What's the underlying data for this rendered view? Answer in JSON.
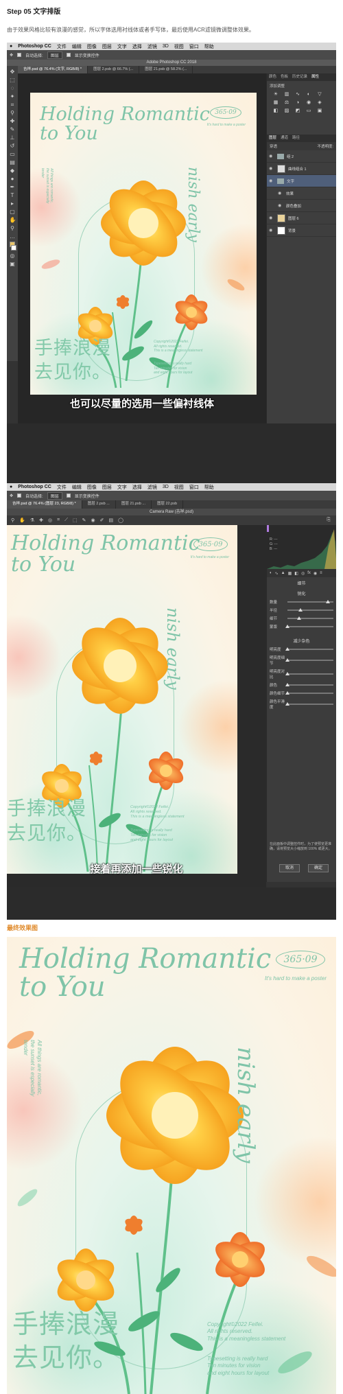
{
  "header": {
    "step_title": "Step 05 文字排版",
    "description": "由于效果风格比较有浪漫的感觉，所以字体选用衬线体或者手写体，最后使用ACR滤镜微调整体效果。"
  },
  "poster": {
    "title_line1": "Holding Romantic",
    "title_line2": "to You",
    "date": "365·09",
    "side_note": "It's hard to make a poster",
    "vertical_text": "nish early",
    "left_vertical": "All things are romantic,\nthe sunset is especially\ntender",
    "title_cn_line1": "手捧浪漫",
    "title_cn_line2": "去见你。",
    "copyright": "Copyright©2022 Feifei.\nAll rights reserved.\nThis is a meaningless statement",
    "typesetting": "Typesetting is really hard\nTen minutes for vision\nand eight hours for layout",
    "colors": {
      "accent_green": "#7fc4a8",
      "petal_yellow": "#f7b733",
      "petal_orange": "#ef7e2e",
      "stem_green": "#5fc08a"
    }
  },
  "shot1": {
    "menubar": [
      "Photoshop CC",
      "文件",
      "编辑",
      "图像",
      "图层",
      "文字",
      "选择",
      "滤镜",
      "3D",
      "视图",
      "窗口",
      "帮助"
    ],
    "options": {
      "auto_select": "自动选择:",
      "auto_select_value": "图层",
      "show_transform": "显示变换控件"
    },
    "window_title": "Adobe Photoshop CC 2018",
    "tabs": [
      "吉祥.psd @ 76.4% (文字, RGB/8) *",
      "图层 2.psb @ 66.7% (...",
      "图层 21.psb @ 58.2% (..."
    ],
    "panels": {
      "tabs": [
        "颜色",
        "色板",
        "历史记录",
        "属性"
      ],
      "adjust_label": "添加调整",
      "layer_tabs": [
        "图层",
        "通道",
        "路径"
      ],
      "blend_mode": "穿透",
      "opacity_label": "不透明度:",
      "layers": [
        {
          "name": "组 2",
          "type": "folder"
        },
        {
          "name": "曲线组合 1",
          "type": "adjust"
        },
        {
          "name": "文字",
          "type": "folder"
        },
        {
          "name": "效果",
          "type": "effect"
        },
        {
          "name": "颜色叠加",
          "type": "effect"
        },
        {
          "name": "图层 6",
          "type": "layer"
        },
        {
          "name": "背景",
          "type": "layer"
        }
      ]
    },
    "subtitle": "也可以尽量的选用一些偏衬线体"
  },
  "shot2": {
    "menubar": [
      "Photoshop CC",
      "文件",
      "编辑",
      "图像",
      "图层",
      "文字",
      "选择",
      "滤镜",
      "3D",
      "视图",
      "窗口",
      "帮助"
    ],
    "options": {
      "auto_select": "自动选择:",
      "auto_select_value": "图层",
      "show_transform": "显示变换控件"
    },
    "tabs": [
      "吉祥.psd @ 76.4% (图层 23, RGB/8) *",
      "图层 2.psb ...",
      "图层 21.psb ...",
      "图层 22.psb"
    ],
    "camera_raw_title": "Camera Raw (吉祥.psd)",
    "histogram_info": "R: ---\nG: ---\nB: ---",
    "section_title": "细节",
    "sharpen_title": "锐化",
    "sharpen_sliders": [
      {
        "label": "数量",
        "value": 0.88
      },
      {
        "label": "半径",
        "value": 0.28
      },
      {
        "label": "细节",
        "value": 0.25
      },
      {
        "label": "蒙版",
        "value": 0.0
      }
    ],
    "noise_title": "减少杂色",
    "noise_sliders": [
      {
        "label": "明亮度",
        "value": 0.0
      },
      {
        "label": "明亮度细节",
        "value": 0.0
      },
      {
        "label": "明亮度对比",
        "value": 0.0
      },
      {
        "label": "颜色",
        "value": 0.0
      },
      {
        "label": "颜色细节",
        "value": 0.0
      },
      {
        "label": "颜色平滑度",
        "value": 0.0
      }
    ],
    "hint": "在此面板中调整控件时，为了使预览更准确，请将预览大小缩放到 100% 或更大。",
    "cancel_label": "取消",
    "ok_label": "确定",
    "subtitle": "接着再添加一些锐化"
  },
  "final": {
    "label": "最终效果图"
  }
}
